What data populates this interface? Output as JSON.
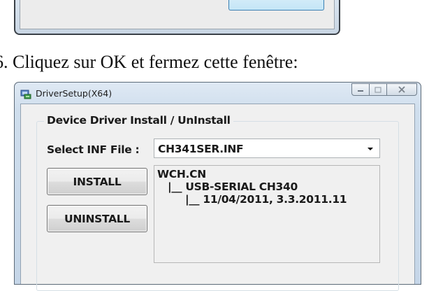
{
  "instruction": "6. Cliquez sur OK et fermez cette fenêtre:",
  "window": {
    "title": "DriverSetup(X64)",
    "app_icon": "driver-setup-icon",
    "caption_buttons": {
      "minimize": "minimize-icon",
      "maximize": "maximize-icon",
      "close": "close-icon"
    }
  },
  "group": {
    "title": "Device Driver Install / UnInstall",
    "inf_label": "Select INF File :",
    "inf_value": "CH341SER.INF",
    "install_label": "INSTALL",
    "uninstall_label": "UNINSTALL",
    "info_lines": [
      "WCH.CN",
      "|__ USB-SERIAL CH340",
      "|__ 11/04/2011, 3.3.2011.11"
    ]
  },
  "colors": {
    "window_frame": "#c5d6e8",
    "client_background": "#f0f0f0",
    "button_border": "#707070"
  }
}
